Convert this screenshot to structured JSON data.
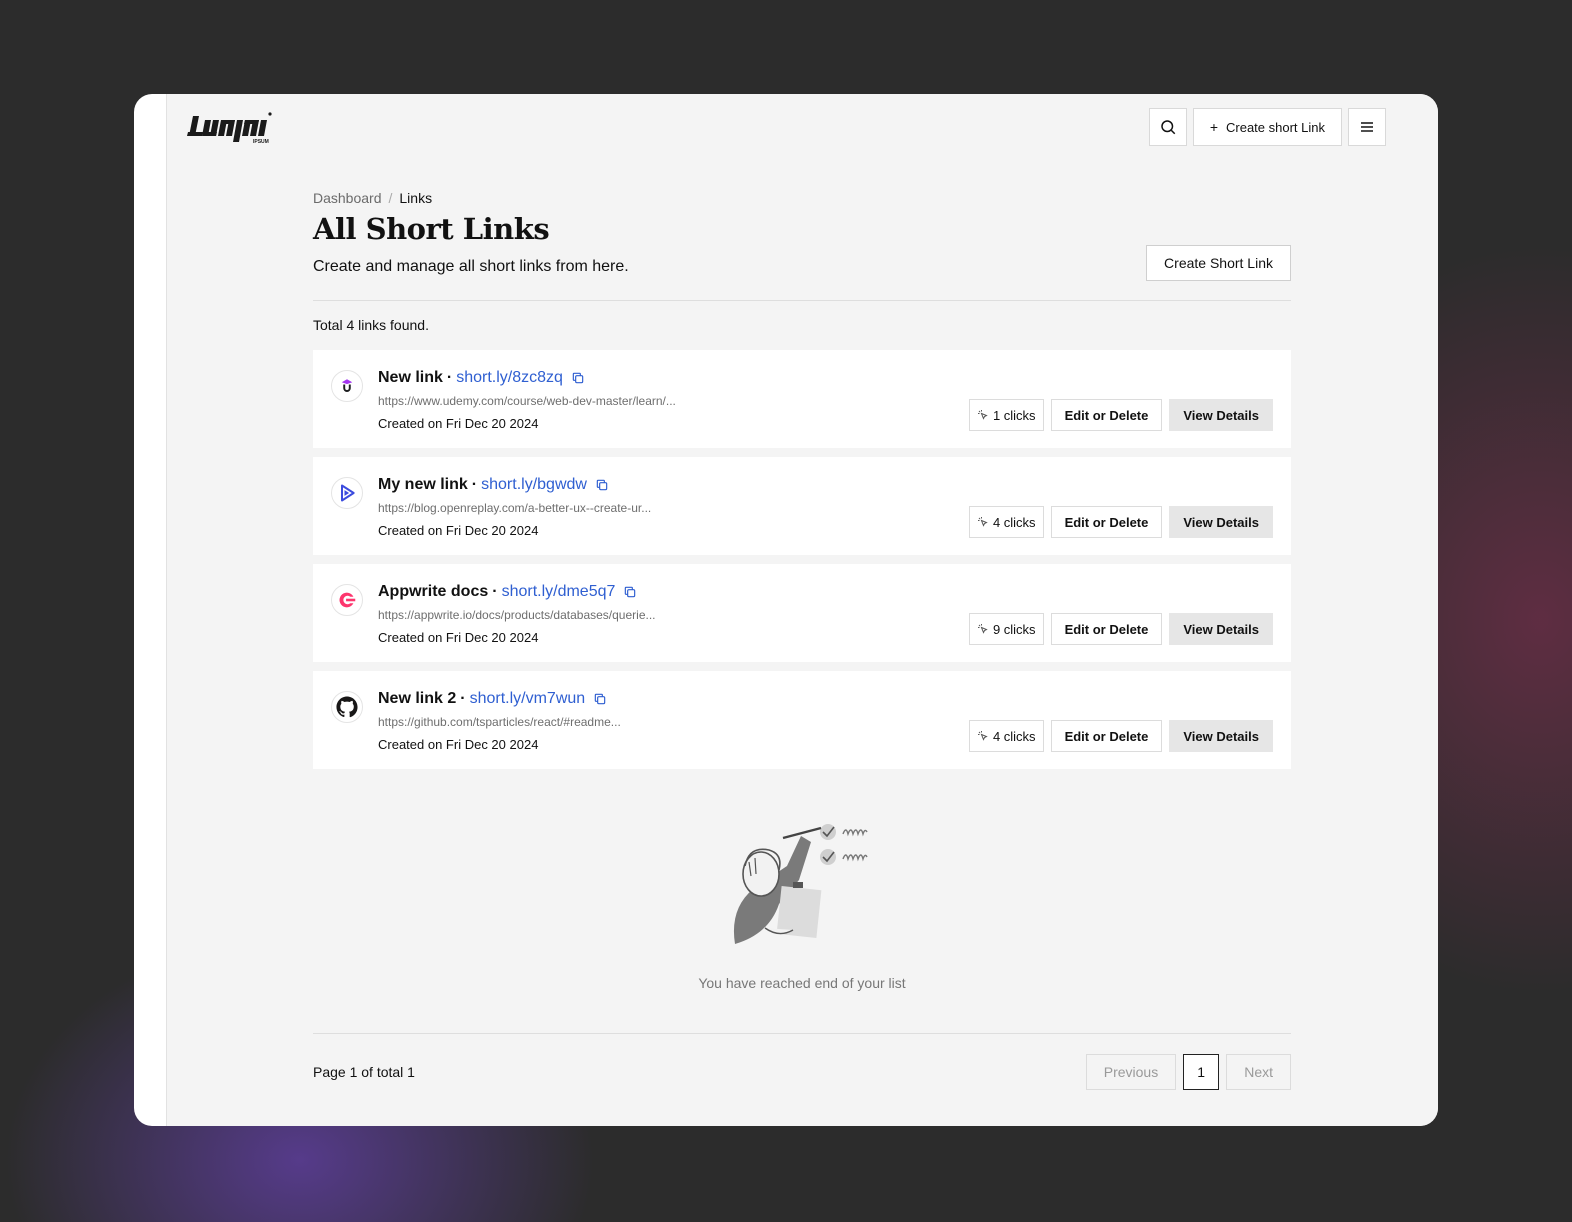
{
  "header": {
    "logo_text": "logo ipsum",
    "create_short_link_label": "Create short Link"
  },
  "breadcrumb": [
    {
      "label": "Dashboard"
    },
    {
      "label": "/"
    },
    {
      "label": "Links"
    }
  ],
  "page": {
    "title": "All Short Links",
    "subtitle": "Create and manage all short links from here.",
    "create_button_label": "Create Short Link",
    "total_text": "Total 4 links found."
  },
  "links": [
    {
      "name": "New link",
      "separator": "·",
      "short_url": "short.ly/8zc8zq",
      "original_url": "https://www.udemy.com/course/web-dev-master/learn/...",
      "created": "Created on Fri Dec 20 2024",
      "clicks": "1 clicks",
      "favicon": "udemy-icon"
    },
    {
      "name": "My new link",
      "separator": "·",
      "short_url": "short.ly/bgwdw",
      "original_url": "https://blog.openreplay.com/a-better-ux--create-ur...",
      "created": "Created on Fri Dec 20 2024",
      "clicks": "4 clicks",
      "favicon": "openreplay-icon"
    },
    {
      "name": "Appwrite docs",
      "separator": "·",
      "short_url": "short.ly/dme5q7",
      "original_url": "https://appwrite.io/docs/products/databases/querie...",
      "created": "Created on Fri Dec 20 2024",
      "clicks": "9 clicks",
      "favicon": "appwrite-icon"
    },
    {
      "name": "New link 2",
      "separator": "·",
      "short_url": "short.ly/vm7wun",
      "original_url": "https://github.com/tsparticles/react/#readme...",
      "created": "Created on Fri Dec 20 2024",
      "clicks": "4 clicks",
      "favicon": "github-icon"
    }
  ],
  "link_actions": {
    "edit_label": "Edit or Delete",
    "view_label": "View Details"
  },
  "empty_state": {
    "text": "You have reached end of your list"
  },
  "pagination": {
    "info": "Page 1 of total 1",
    "previous_label": "Previous",
    "current_page": "1",
    "next_label": "Next"
  },
  "colors": {
    "link_blue": "#2f5fd1",
    "app_background": "#f4f4f4",
    "view_button_bg": "#e6e6e6"
  }
}
